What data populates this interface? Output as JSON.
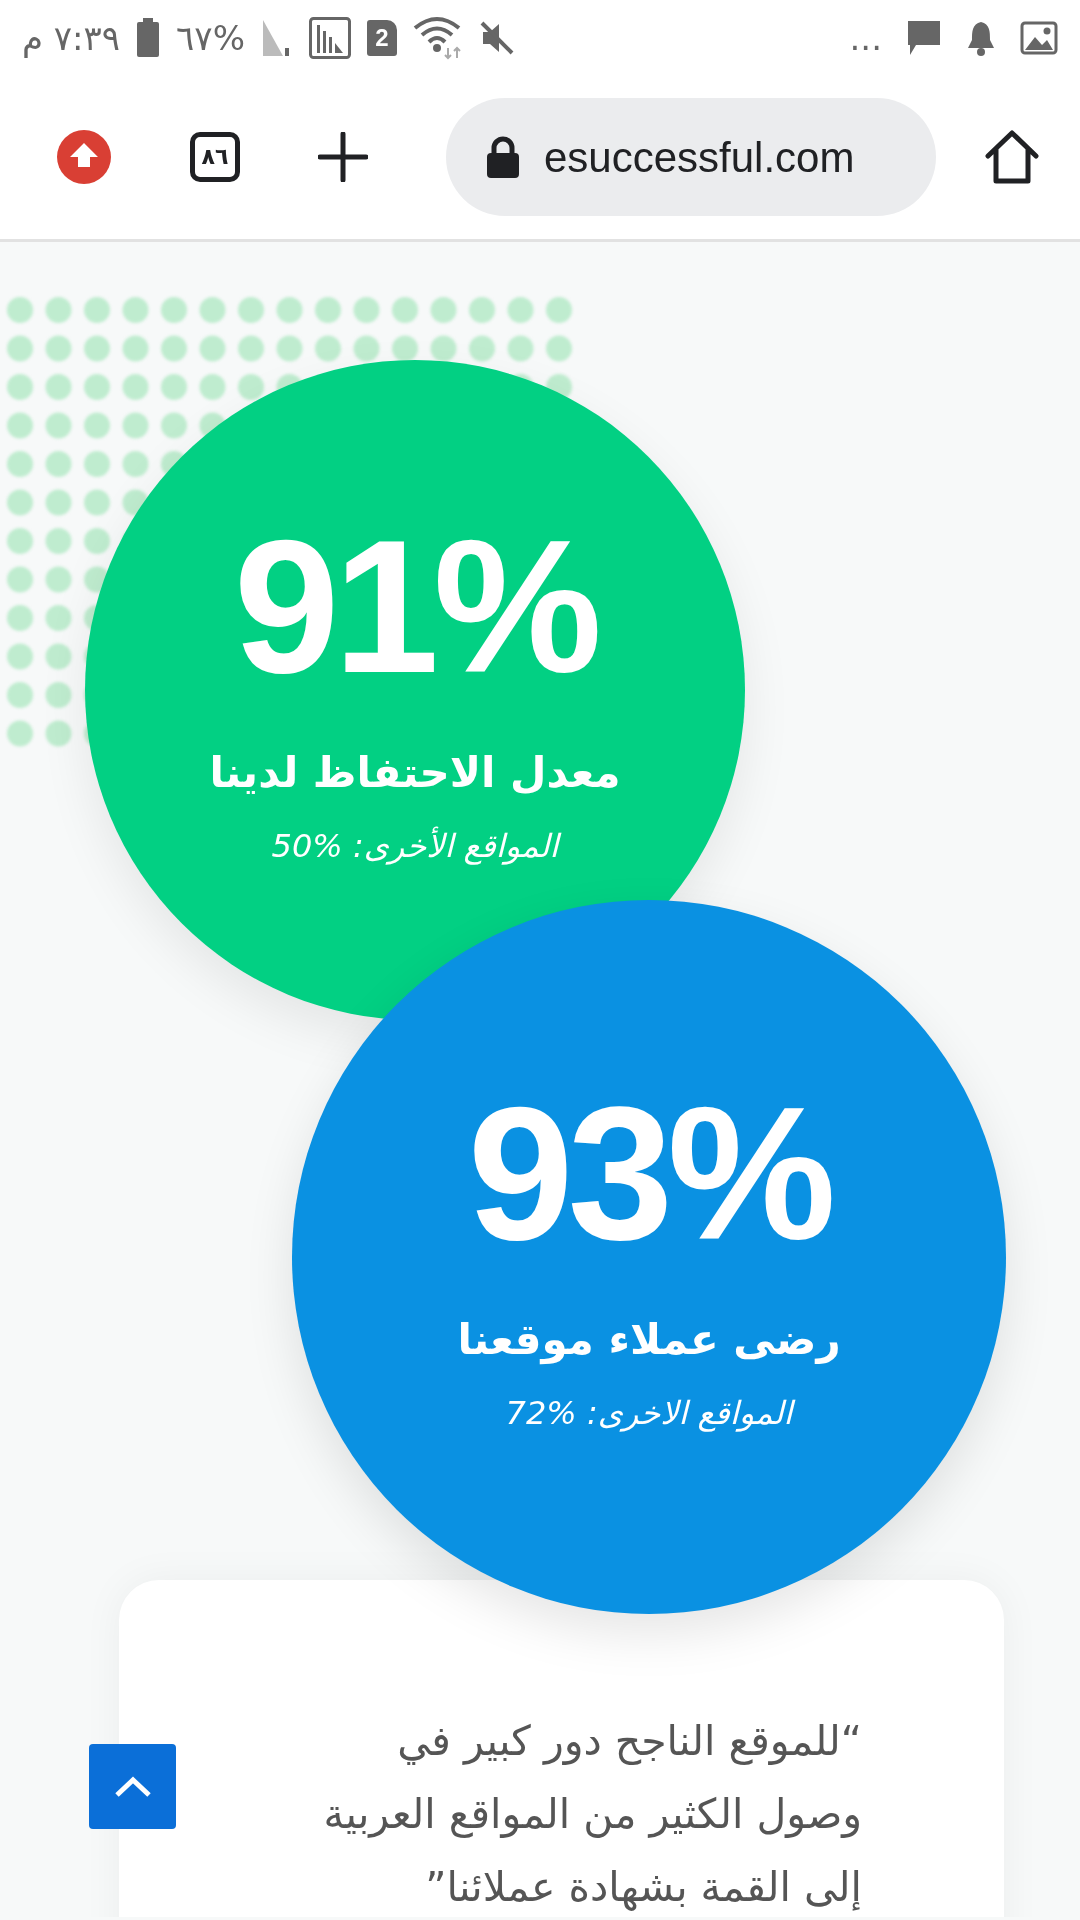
{
  "status_bar": {
    "time": "٧:٣٩ م",
    "battery": "%٦٧",
    "sim_slot": "2",
    "overflow": "..."
  },
  "browser": {
    "tab_count": "٨٦",
    "url": "esuccessful.com"
  },
  "stats": [
    {
      "value": "91%",
      "label": "معدل الاحتفاظ لدينا",
      "comparison": "المواقع الأخرى: %50",
      "color": "#02d083"
    },
    {
      "value": "93%",
      "label": "رضى عملاء موقعنا",
      "comparison": "المواقع الاخرى: %72",
      "color": "#0a91e2"
    }
  ],
  "quote": {
    "text": "“للموقع الناجح دور كبير في وصول الكثير من المواقع العربية إلى القمة بشهادة عملائنا”"
  }
}
